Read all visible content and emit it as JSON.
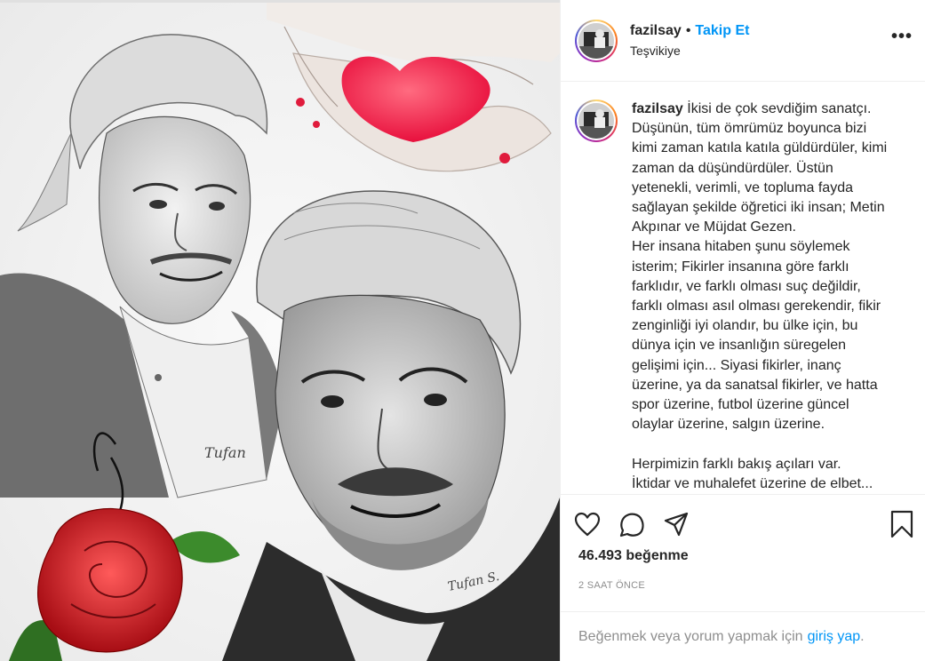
{
  "post": {
    "username": "fazilsay",
    "separator": "•",
    "follow_label": "Takip Et",
    "location": "Teşvikiye",
    "more_label": "•••",
    "caption_text": "İkisi de çok sevdiğim sanatçı.\nDüşünün, tüm ömrümüz boyunca bizi kimi zaman katıla katıla güldürdüler, kimi zaman da düşündürdüler. Üstün yetenekli, verimli, ve topluma fayda sağlayan şekilde öğretici iki insan; Metin Akpınar ve Müjdat Gezen.\nHer insana hitaben şunu söylemek isterim; Fikirler insanına göre farklı farklıdır, ve farklı olması suç değildir, farklı olması asıl olması gerekendir, fikir zenginliği iyi olandır, bu ülke için, bu dünya için ve insanlığın süregelen gelişimi için... Siyasi fikirler, inanç üzerine, ya da sanatsal fikirler, ve hatta spor üzerine, futbol üzerine güncel olaylar üzerine, salgın üzerine.\n\nHerpimizin farklı bakış açıları var.\nİktidar ve muhalefet üzerine de elbet...",
    "likes_label": "46.493 beğenme",
    "time_label": "2 SAAT ÖNCE",
    "login_prompt": "Beğenmek veya yorum yapmak için",
    "login_link": "giriş yap",
    "login_end": "."
  },
  "icons": {
    "like": "heart-outline-icon",
    "comment": "comment-bubble-icon",
    "share": "paper-plane-icon",
    "save": "bookmark-icon",
    "more": "more-dots-icon"
  },
  "image": {
    "signature_top": "Tufan",
    "signature_bottom": "Tufan S."
  },
  "colors": {
    "accent": "#0095f6",
    "heart": "#ff2a55",
    "rose": "#d8121f",
    "text": "#262626",
    "muted": "#8e8e8e"
  }
}
